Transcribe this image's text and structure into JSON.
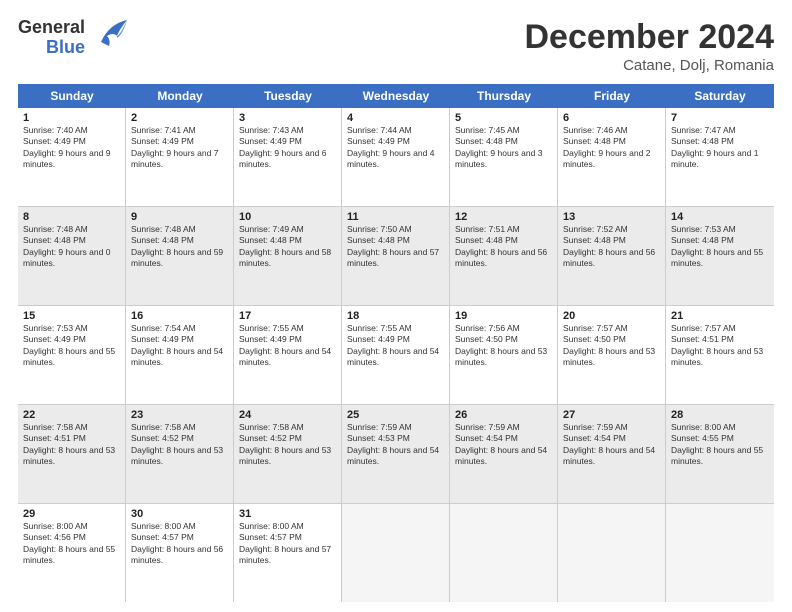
{
  "header": {
    "logo_line1": "General",
    "logo_line2": "Blue",
    "title": "December 2024",
    "subtitle": "Catane, Dolj, Romania"
  },
  "weekdays": [
    "Sunday",
    "Monday",
    "Tuesday",
    "Wednesday",
    "Thursday",
    "Friday",
    "Saturday"
  ],
  "rows": [
    [
      {
        "day": "1",
        "sunrise": "Sunrise: 7:40 AM",
        "sunset": "Sunset: 4:49 PM",
        "daylight": "Daylight: 9 hours and 9 minutes."
      },
      {
        "day": "2",
        "sunrise": "Sunrise: 7:41 AM",
        "sunset": "Sunset: 4:49 PM",
        "daylight": "Daylight: 9 hours and 7 minutes."
      },
      {
        "day": "3",
        "sunrise": "Sunrise: 7:43 AM",
        "sunset": "Sunset: 4:49 PM",
        "daylight": "Daylight: 9 hours and 6 minutes."
      },
      {
        "day": "4",
        "sunrise": "Sunrise: 7:44 AM",
        "sunset": "Sunset: 4:49 PM",
        "daylight": "Daylight: 9 hours and 4 minutes."
      },
      {
        "day": "5",
        "sunrise": "Sunrise: 7:45 AM",
        "sunset": "Sunset: 4:48 PM",
        "daylight": "Daylight: 9 hours and 3 minutes."
      },
      {
        "day": "6",
        "sunrise": "Sunrise: 7:46 AM",
        "sunset": "Sunset: 4:48 PM",
        "daylight": "Daylight: 9 hours and 2 minutes."
      },
      {
        "day": "7",
        "sunrise": "Sunrise: 7:47 AM",
        "sunset": "Sunset: 4:48 PM",
        "daylight": "Daylight: 9 hours and 1 minute."
      }
    ],
    [
      {
        "day": "8",
        "sunrise": "Sunrise: 7:48 AM",
        "sunset": "Sunset: 4:48 PM",
        "daylight": "Daylight: 9 hours and 0 minutes."
      },
      {
        "day": "9",
        "sunrise": "Sunrise: 7:48 AM",
        "sunset": "Sunset: 4:48 PM",
        "daylight": "Daylight: 8 hours and 59 minutes."
      },
      {
        "day": "10",
        "sunrise": "Sunrise: 7:49 AM",
        "sunset": "Sunset: 4:48 PM",
        "daylight": "Daylight: 8 hours and 58 minutes."
      },
      {
        "day": "11",
        "sunrise": "Sunrise: 7:50 AM",
        "sunset": "Sunset: 4:48 PM",
        "daylight": "Daylight: 8 hours and 57 minutes."
      },
      {
        "day": "12",
        "sunrise": "Sunrise: 7:51 AM",
        "sunset": "Sunset: 4:48 PM",
        "daylight": "Daylight: 8 hours and 56 minutes."
      },
      {
        "day": "13",
        "sunrise": "Sunrise: 7:52 AM",
        "sunset": "Sunset: 4:48 PM",
        "daylight": "Daylight: 8 hours and 56 minutes."
      },
      {
        "day": "14",
        "sunrise": "Sunrise: 7:53 AM",
        "sunset": "Sunset: 4:48 PM",
        "daylight": "Daylight: 8 hours and 55 minutes."
      }
    ],
    [
      {
        "day": "15",
        "sunrise": "Sunrise: 7:53 AM",
        "sunset": "Sunset: 4:49 PM",
        "daylight": "Daylight: 8 hours and 55 minutes."
      },
      {
        "day": "16",
        "sunrise": "Sunrise: 7:54 AM",
        "sunset": "Sunset: 4:49 PM",
        "daylight": "Daylight: 8 hours and 54 minutes."
      },
      {
        "day": "17",
        "sunrise": "Sunrise: 7:55 AM",
        "sunset": "Sunset: 4:49 PM",
        "daylight": "Daylight: 8 hours and 54 minutes."
      },
      {
        "day": "18",
        "sunrise": "Sunrise: 7:55 AM",
        "sunset": "Sunset: 4:49 PM",
        "daylight": "Daylight: 8 hours and 54 minutes."
      },
      {
        "day": "19",
        "sunrise": "Sunrise: 7:56 AM",
        "sunset": "Sunset: 4:50 PM",
        "daylight": "Daylight: 8 hours and 53 minutes."
      },
      {
        "day": "20",
        "sunrise": "Sunrise: 7:57 AM",
        "sunset": "Sunset: 4:50 PM",
        "daylight": "Daylight: 8 hours and 53 minutes."
      },
      {
        "day": "21",
        "sunrise": "Sunrise: 7:57 AM",
        "sunset": "Sunset: 4:51 PM",
        "daylight": "Daylight: 8 hours and 53 minutes."
      }
    ],
    [
      {
        "day": "22",
        "sunrise": "Sunrise: 7:58 AM",
        "sunset": "Sunset: 4:51 PM",
        "daylight": "Daylight: 8 hours and 53 minutes."
      },
      {
        "day": "23",
        "sunrise": "Sunrise: 7:58 AM",
        "sunset": "Sunset: 4:52 PM",
        "daylight": "Daylight: 8 hours and 53 minutes."
      },
      {
        "day": "24",
        "sunrise": "Sunrise: 7:58 AM",
        "sunset": "Sunset: 4:52 PM",
        "daylight": "Daylight: 8 hours and 53 minutes."
      },
      {
        "day": "25",
        "sunrise": "Sunrise: 7:59 AM",
        "sunset": "Sunset: 4:53 PM",
        "daylight": "Daylight: 8 hours and 54 minutes."
      },
      {
        "day": "26",
        "sunrise": "Sunrise: 7:59 AM",
        "sunset": "Sunset: 4:54 PM",
        "daylight": "Daylight: 8 hours and 54 minutes."
      },
      {
        "day": "27",
        "sunrise": "Sunrise: 7:59 AM",
        "sunset": "Sunset: 4:54 PM",
        "daylight": "Daylight: 8 hours and 54 minutes."
      },
      {
        "day": "28",
        "sunrise": "Sunrise: 8:00 AM",
        "sunset": "Sunset: 4:55 PM",
        "daylight": "Daylight: 8 hours and 55 minutes."
      }
    ],
    [
      {
        "day": "29",
        "sunrise": "Sunrise: 8:00 AM",
        "sunset": "Sunset: 4:56 PM",
        "daylight": "Daylight: 8 hours and 55 minutes."
      },
      {
        "day": "30",
        "sunrise": "Sunrise: 8:00 AM",
        "sunset": "Sunset: 4:57 PM",
        "daylight": "Daylight: 8 hours and 56 minutes."
      },
      {
        "day": "31",
        "sunrise": "Sunrise: 8:00 AM",
        "sunset": "Sunset: 4:57 PM",
        "daylight": "Daylight: 8 hours and 57 minutes."
      },
      null,
      null,
      null,
      null
    ]
  ]
}
